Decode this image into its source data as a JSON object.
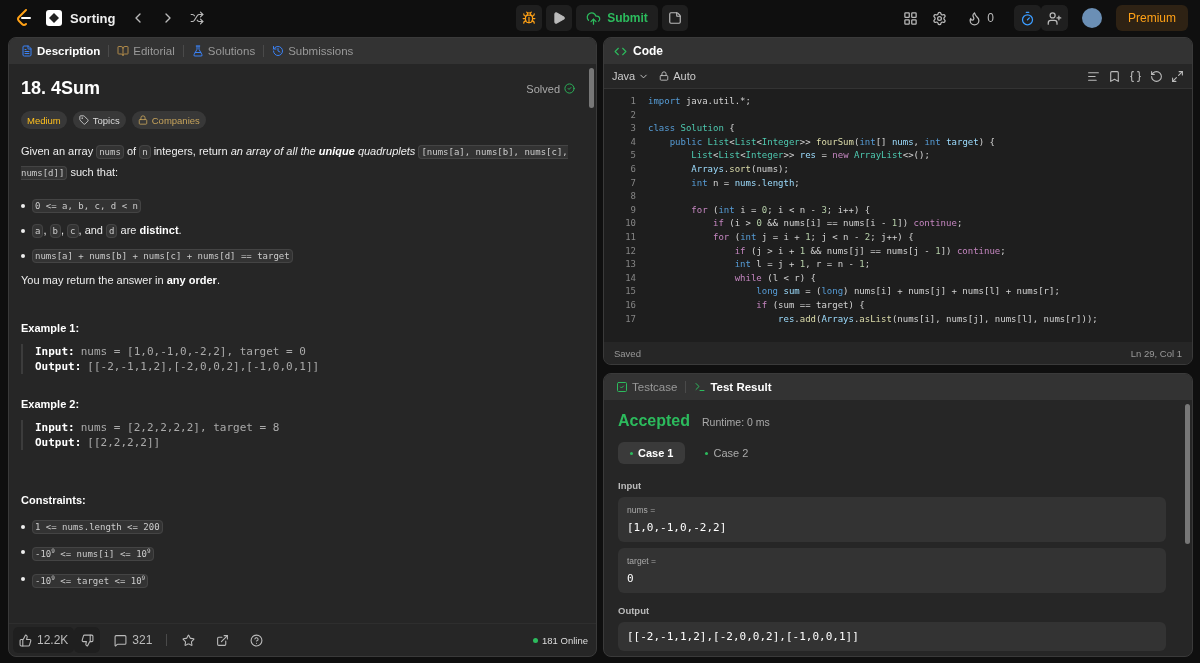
{
  "topbar": {
    "problem_list": "Sorting",
    "submit": "Submit",
    "streak": "0",
    "premium": "Premium"
  },
  "description_panel": {
    "tabs": [
      {
        "label": "Description",
        "selected": true
      },
      {
        "label": "Editorial",
        "selected": false
      },
      {
        "label": "Solutions",
        "selected": false
      },
      {
        "label": "Submissions",
        "selected": false
      }
    ],
    "title": "18. 4Sum",
    "status": "Solved",
    "tags": [
      {
        "label": "Medium",
        "kind": "difficulty"
      },
      {
        "label": "Topics",
        "kind": "topics"
      },
      {
        "label": "Companies",
        "kind": "companies"
      }
    ],
    "content": [
      {
        "kind": "paragraph",
        "segments": [
          {
            "kind": "text",
            "text": "Given an array "
          },
          {
            "kind": "code",
            "text": "nums"
          },
          {
            "kind": "text",
            "text": " of "
          },
          {
            "kind": "code",
            "text": "n"
          },
          {
            "kind": "text",
            "text": " integers, return "
          },
          {
            "kind": "emphasis",
            "text": "an array of all the **unique** quadruplets "
          },
          {
            "kind": "code",
            "text": "[nums[a], nums[b], nums[c], nums[d]]"
          },
          {
            "kind": "text",
            "text": " such that:"
          }
        ]
      },
      {
        "kind": "bullet",
        "segments": [
          {
            "kind": "code",
            "text": "0 <= a, b, c, d < n"
          }
        ]
      },
      {
        "kind": "bullet",
        "segments": [
          {
            "kind": "code",
            "text": "a"
          },
          {
            "kind": "text",
            "text": ", "
          },
          {
            "kind": "code",
            "text": "b"
          },
          {
            "kind": "text",
            "text": ", "
          },
          {
            "kind": "code",
            "text": "c"
          },
          {
            "kind": "text",
            "text": ", and "
          },
          {
            "kind": "code",
            "text": "d"
          },
          {
            "kind": "text",
            "text": " are **distinct**."
          }
        ]
      },
      {
        "kind": "bullet",
        "segments": [
          {
            "kind": "code",
            "text": "nums[a] + nums[b] + nums[c] + nums[d] == target"
          }
        ]
      },
      {
        "kind": "paragraph",
        "segments": [
          {
            "kind": "text",
            "text": "You may return the answer in **any order**."
          }
        ]
      }
    ],
    "examples": [
      {
        "title": "Example 1:",
        "lines": [
          {
            "label": "Input:",
            "value": "nums = [1,0,-1,0,-2,2], target = 0"
          },
          {
            "label": "Output:",
            "value": "[[-2,-1,1,2],[-2,0,0,2],[-1,0,0,1]]"
          }
        ]
      },
      {
        "title": "Example 2:",
        "lines": [
          {
            "label": "Input:",
            "value": "nums = [2,2,2,2,2], target = 8"
          },
          {
            "label": "Output:",
            "value": "[[2,2,2,2]]"
          }
        ]
      }
    ],
    "constraints_title": "Constraints:",
    "constraints": [
      "1 <= nums.length <= 200",
      "-10$^{9}$ <= nums[i] <= 10$^{9}$",
      "-10$^{9}$ <= target <= 10$^{9}$"
    ],
    "likes": "12.2K",
    "comments": "321",
    "online": "181 Online"
  },
  "code_panel": {
    "title": "Code",
    "language": "Java",
    "mode": "Auto",
    "lines": [
      {
        "number": "1",
        "tokens": [
          {
            "kind": "keyword",
            "text": "import "
          },
          {
            "kind": "plain",
            "text": "java.util.*;"
          }
        ]
      },
      {
        "number": "2"
      },
      {
        "number": "3",
        "tokens": [
          {
            "kind": "keyword",
            "text": "class "
          },
          {
            "kind": "type",
            "text": "Solution"
          },
          {
            "kind": "plain",
            "text": " {"
          }
        ]
      },
      {
        "number": "4",
        "tokens": [
          {
            "kind": "keyword",
            "text": "    public "
          },
          {
            "kind": "type",
            "text": "List"
          },
          {
            "kind": "plain",
            "text": "<"
          },
          {
            "kind": "type",
            "text": "List"
          },
          {
            "kind": "plain",
            "text": "<"
          },
          {
            "kind": "type",
            "text": "Integer"
          },
          {
            "kind": "plain",
            "text": ">> "
          },
          {
            "kind": "function",
            "text": "fourSum"
          },
          {
            "kind": "plain",
            "text": "("
          },
          {
            "kind": "keyword",
            "text": "int"
          },
          {
            "kind": "plain",
            "text": "[] "
          },
          {
            "kind": "variable",
            "text": "nums"
          },
          {
            "kind": "plain",
            "text": ", "
          },
          {
            "kind": "keyword",
            "text": "int "
          },
          {
            "kind": "variable",
            "text": "target"
          },
          {
            "kind": "plain",
            "text": ") {"
          }
        ]
      },
      {
        "number": "5",
        "tokens": [
          {
            "kind": "type",
            "text": "        List"
          },
          {
            "kind": "plain",
            "text": "<"
          },
          {
            "kind": "type",
            "text": "List"
          },
          {
            "kind": "plain",
            "text": "<"
          },
          {
            "kind": "type",
            "text": "Integer"
          },
          {
            "kind": "plain",
            "text": ">> "
          },
          {
            "kind": "variable",
            "text": "res"
          },
          {
            "kind": "plain",
            "text": " = "
          },
          {
            "kind": "control",
            "text": "new "
          },
          {
            "kind": "type",
            "text": "ArrayList"
          },
          {
            "kind": "plain",
            "text": "<>();"
          }
        ]
      },
      {
        "number": "6",
        "tokens": [
          {
            "kind": "variable",
            "text": "        Arrays"
          },
          {
            "kind": "plain",
            "text": "."
          },
          {
            "kind": "function",
            "text": "sort"
          },
          {
            "kind": "plain",
            "text": "(nums);"
          }
        ]
      },
      {
        "number": "7",
        "tokens": [
          {
            "kind": "keyword",
            "text": "        int"
          },
          {
            "kind": "plain",
            "text": " n = "
          },
          {
            "kind": "variable",
            "text": "nums"
          },
          {
            "kind": "plain",
            "text": "."
          },
          {
            "kind": "variable",
            "text": "length"
          },
          {
            "kind": "plain",
            "text": ";"
          }
        ]
      },
      {
        "number": "8"
      },
      {
        "number": "9",
        "tokens": [
          {
            "kind": "control",
            "text": "        for"
          },
          {
            "kind": "plain",
            "text": " ("
          },
          {
            "kind": "keyword",
            "text": "int"
          },
          {
            "kind": "plain",
            "text": " i = "
          },
          {
            "kind": "number",
            "text": "0"
          },
          {
            "kind": "plain",
            "text": "; i < n - "
          },
          {
            "kind": "number",
            "text": "3"
          },
          {
            "kind": "plain",
            "text": "; i++) {"
          }
        ]
      },
      {
        "number": "10",
        "tokens": [
          {
            "kind": "control",
            "text": "            if"
          },
          {
            "kind": "plain",
            "text": " (i > "
          },
          {
            "kind": "number",
            "text": "0"
          },
          {
            "kind": "plain",
            "text": " && nums[i] == nums[i - "
          },
          {
            "kind": "number",
            "text": "1"
          },
          {
            "kind": "plain",
            "text": "]) "
          },
          {
            "kind": "control",
            "text": "continue"
          },
          {
            "kind": "plain",
            "text": ";"
          }
        ]
      },
      {
        "number": "11",
        "tokens": [
          {
            "kind": "control",
            "text": "            for"
          },
          {
            "kind": "plain",
            "text": " ("
          },
          {
            "kind": "keyword",
            "text": "int"
          },
          {
            "kind": "plain",
            "text": " j = i + "
          },
          {
            "kind": "number",
            "text": "1"
          },
          {
            "kind": "plain",
            "text": "; j < n - "
          },
          {
            "kind": "number",
            "text": "2"
          },
          {
            "kind": "plain",
            "text": "; j++) {"
          }
        ]
      },
      {
        "number": "12",
        "tokens": [
          {
            "kind": "control",
            "text": "                if"
          },
          {
            "kind": "plain",
            "text": " (j > i + "
          },
          {
            "kind": "number",
            "text": "1"
          },
          {
            "kind": "plain",
            "text": " && nums[j] == nums[j - "
          },
          {
            "kind": "number",
            "text": "1"
          },
          {
            "kind": "plain",
            "text": "]) "
          },
          {
            "kind": "control",
            "text": "continue"
          },
          {
            "kind": "plain",
            "text": ";"
          }
        ]
      },
      {
        "number": "13",
        "tokens": [
          {
            "kind": "keyword",
            "text": "                int"
          },
          {
            "kind": "plain",
            "text": " l = j + "
          },
          {
            "kind": "number",
            "text": "1"
          },
          {
            "kind": "plain",
            "text": ", r = n - "
          },
          {
            "kind": "number",
            "text": "1"
          },
          {
            "kind": "plain",
            "text": ";"
          }
        ]
      },
      {
        "number": "14",
        "tokens": [
          {
            "kind": "control",
            "text": "                while"
          },
          {
            "kind": "plain",
            "text": " (l < r) {"
          }
        ]
      },
      {
        "number": "15",
        "tokens": [
          {
            "kind": "keyword",
            "text": "                    long "
          },
          {
            "kind": "variable",
            "text": "sum"
          },
          {
            "kind": "plain",
            "text": " = ("
          },
          {
            "kind": "keyword",
            "text": "long"
          },
          {
            "kind": "plain",
            "text": ") nums[i] + nums[j] + nums[l] + nums[r];"
          }
        ]
      },
      {
        "number": "16",
        "tokens": [
          {
            "kind": "control",
            "text": "                    if"
          },
          {
            "kind": "plain",
            "text": " (sum == target) {"
          }
        ]
      },
      {
        "number": "17",
        "tokens": [
          {
            "kind": "variable",
            "text": "                        res"
          },
          {
            "kind": "plain",
            "text": "."
          },
          {
            "kind": "function",
            "text": "add"
          },
          {
            "kind": "plain",
            "text": "("
          },
          {
            "kind": "variable",
            "text": "Arrays"
          },
          {
            "kind": "plain",
            "text": "."
          },
          {
            "kind": "function",
            "text": "asList"
          },
          {
            "kind": "plain",
            "text": "(nums[i], nums[j], nums[l], nums[r]));"
          }
        ]
      }
    ],
    "saved": "Saved",
    "cursor": "Ln 29, Col 1"
  },
  "result_panel": {
    "tabs": [
      {
        "label": "Testcase",
        "selected": false
      },
      {
        "label": "Test Result",
        "selected": true
      }
    ],
    "verdict": "Accepted",
    "runtime": "Runtime: 0 ms",
    "cases": [
      {
        "label": "Case 1",
        "selected": true
      },
      {
        "label": "Case 2",
        "selected": false
      }
    ],
    "input_label": "Input",
    "inputs": [
      {
        "name": "nums =",
        "value": "[1,0,-1,0,-2,2]"
      },
      {
        "name": "target =",
        "value": "0"
      }
    ],
    "output_label": "Output",
    "output": "[[-2,-1,1,2],[-2,0,0,2],[-1,0,0,1]]"
  }
}
